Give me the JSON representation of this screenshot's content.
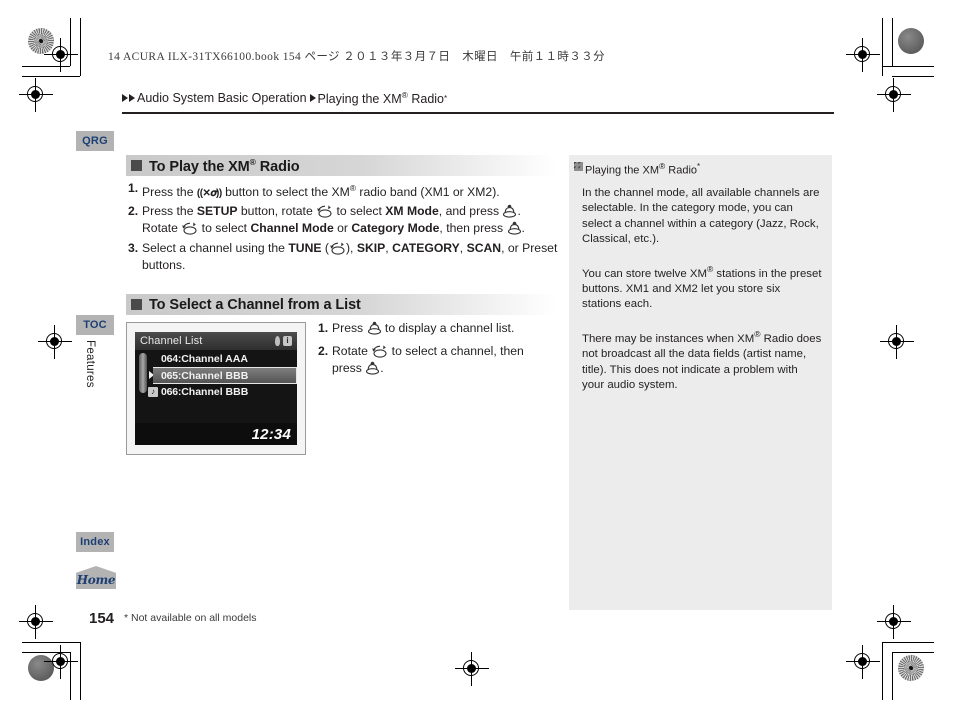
{
  "print_slug": "14 ACURA ILX-31TX66100.book   154 ページ   ２０１３年３月７日　木曜日　午前１１時３３分",
  "breadcrumb": {
    "section": "Audio System Basic Operation",
    "topic": "Playing the XM® Radio",
    "topic_asterisk": "*"
  },
  "sidebar": {
    "qrg": "QRG",
    "toc": "TOC",
    "index": "Index",
    "home": "Home",
    "vertical_label": "Features"
  },
  "sections": [
    {
      "id": "play",
      "title": "To Play the XM® Radio",
      "steps": [
        {
          "num": "1.",
          "parts": [
            {
              "t": "Press the ",
              "b": false
            },
            {
              "t": "XM-BUTTON-ICON",
              "b": false,
              "icon": "xm-band-button-icon"
            },
            {
              "t": " button to select the XM® radio band (XM1 or XM2).",
              "b": false
            }
          ]
        },
        {
          "num": "2.",
          "parts": [
            {
              "t": "Press the ",
              "b": false
            },
            {
              "t": "SETUP",
              "b": true
            },
            {
              "t": " button, rotate ",
              "b": false
            },
            {
              "t": "ROTATE-ICON",
              "icon": "rotate-knob-icon"
            },
            {
              "t": " to select ",
              "b": false
            },
            {
              "t": "XM Mode",
              "b": true
            },
            {
              "t": ", and press ",
              "b": false
            },
            {
              "t": "PRESS-ICON",
              "icon": "press-knob-icon"
            },
            {
              "t": ". Rotate ",
              "b": false
            },
            {
              "t": "ROTATE-ICON",
              "icon": "rotate-knob-icon"
            },
            {
              "t": " to select ",
              "b": false
            },
            {
              "t": "Channel Mode",
              "b": true
            },
            {
              "t": " or ",
              "b": false
            },
            {
              "t": "Category Mode",
              "b": true
            },
            {
              "t": ", then press ",
              "b": false
            },
            {
              "t": "PRESS-ICON",
              "icon": "press-knob-icon"
            },
            {
              "t": ".",
              "b": false
            }
          ]
        },
        {
          "num": "3.",
          "parts": [
            {
              "t": "Select a channel using the ",
              "b": false
            },
            {
              "t": "TUNE",
              "b": true
            },
            {
              "t": " (",
              "b": false
            },
            {
              "t": "ROTATE-ICON",
              "icon": "rotate-knob-icon"
            },
            {
              "t": "), ",
              "b": false
            },
            {
              "t": "SKIP",
              "b": true
            },
            {
              "t": ", ",
              "b": false
            },
            {
              "t": "CATEGORY",
              "b": true
            },
            {
              "t": ", ",
              "b": false
            },
            {
              "t": "SCAN",
              "b": true
            },
            {
              "t": ", or Preset buttons.",
              "b": false
            }
          ]
        }
      ]
    },
    {
      "id": "list",
      "title": "To Select a Channel from a List",
      "steps": [
        {
          "num": "1.",
          "parts": [
            {
              "t": "Press ",
              "b": false
            },
            {
              "t": "PRESS-ICON",
              "icon": "press-knob-icon"
            },
            {
              "t": " to display a channel list.",
              "b": false
            }
          ]
        },
        {
          "num": "2.",
          "parts": [
            {
              "t": "Rotate ",
              "b": false
            },
            {
              "t": "ROTATE-ICON",
              "icon": "rotate-knob-icon"
            },
            {
              "t": " to select a channel, then press ",
              "b": false
            },
            {
              "t": "PRESS-ICON",
              "icon": "press-knob-icon"
            },
            {
              "t": ".",
              "b": false
            }
          ]
        }
      ]
    }
  ],
  "audio_screen": {
    "title": "Channel List",
    "status_icons": [
      "signal-icon",
      "info-icon"
    ],
    "info_glyph": "i",
    "rows": [
      {
        "number": "064:",
        "name": "Channel AAA",
        "selected": false,
        "has_note_icon": false
      },
      {
        "number": "065:",
        "name": "Channel BBB",
        "selected": true,
        "has_note_icon": false
      },
      {
        "number": "066:",
        "name": "Channel BBB",
        "selected": false,
        "has_note_icon": true,
        "note_glyph": "♪"
      }
    ],
    "clock": "12:34"
  },
  "note_panel": {
    "heading": "Playing the XM® Radio",
    "heading_asterisk": "*",
    "paragraphs": [
      "In the channel mode, all available channels are selectable. In the category mode, you can select a channel within a category (Jazz, Rock, Classical, etc.).",
      "You can store twelve XM® stations in the preset buttons. XM1 and XM2 let you store six stations each.",
      "There may be instances when XM® Radio does not broadcast all the data fields (artist name, title). This does not indicate a problem with your audio system."
    ]
  },
  "footer": {
    "page_number": "154",
    "footnote": "* Not available on all models"
  },
  "colors": {
    "tab_bg": "#b3b3b3",
    "tab_text": "#1d3f73",
    "section_head_bg": "#d0d0d0",
    "note_panel_bg": "#ececec",
    "screen_bg": "#141414"
  }
}
